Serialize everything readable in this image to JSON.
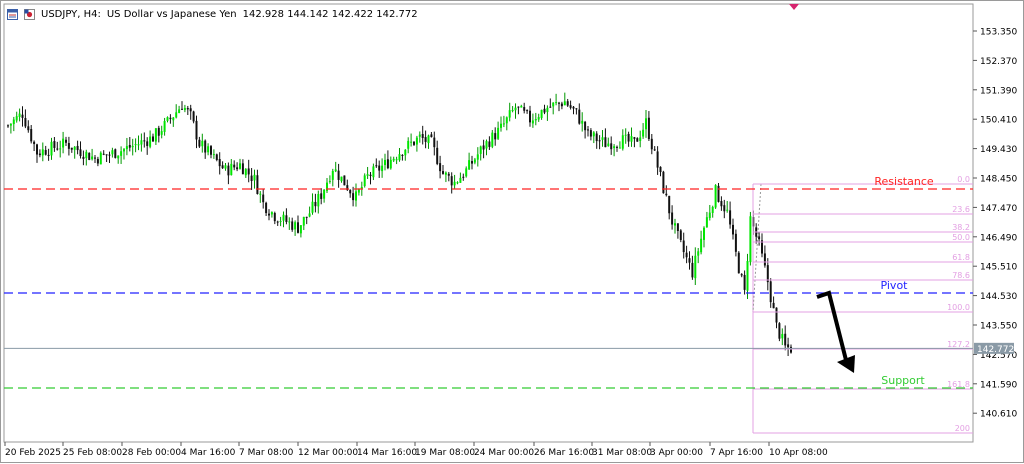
{
  "header": {
    "symbol_timeframe": "USDJPY, H4:",
    "description": "US Dollar vs Japanese Yen",
    "ohlc": "142.928 144.142 142.422 142.772"
  },
  "price_axis": {
    "ticks": [
      "153.350",
      "152.370",
      "151.390",
      "150.410",
      "149.430",
      "148.450",
      "147.470",
      "146.490",
      "145.510",
      "144.530",
      "143.550",
      "142.570",
      "141.590",
      "140.610"
    ],
    "current_price_label": "142.772"
  },
  "time_axis": {
    "labels": [
      "20 Feb 2025",
      "25 Feb 08:00",
      "28 Feb 00:00",
      "4 Mar 16:00",
      "7 Mar 08:00",
      "12 Mar 00:00",
      "14 Mar 16:00",
      "19 Mar 08:00",
      "24 Mar 00:00",
      "26 Mar 16:00",
      "31 Mar 08:00",
      "3 Apr 00:00",
      "7 Apr 16:00",
      "10 Apr 08:00"
    ]
  },
  "annotations": {
    "resistance": {
      "label": "Resistance",
      "price": 148.05,
      "color": "#ff2222"
    },
    "pivot": {
      "label": "Pivot",
      "price": 144.62,
      "color": "#2222ff"
    },
    "support": {
      "label": "Support",
      "price": 141.42,
      "color": "#33cc33"
    }
  },
  "fibonacci": {
    "color": "#e3a0e3",
    "levels": [
      "0.0",
      "23.6",
      "38.2",
      "50.0",
      "61.8",
      "78.6",
      "100.0",
      "127.2",
      "161.8",
      "200"
    ]
  },
  "colors": {
    "bull_candle": "#00e600",
    "bear_candle": "#111111",
    "current_price_line": "#8a9aa6",
    "axis_label_bg": "#8a9aa6",
    "arrow": "#000000"
  },
  "chart_data": {
    "type": "candlestick",
    "symbol": "USDJPY",
    "timeframe": "H4",
    "ylim": [
      140.0,
      154.0
    ],
    "horizontal_lines": [
      {
        "name": "Resistance",
        "y": 148.05
      },
      {
        "name": "Pivot",
        "y": 144.62
      },
      {
        "name": "Support",
        "y": 141.42
      }
    ],
    "approx_close_path": [
      [
        0,
        150.2
      ],
      [
        5,
        150.6
      ],
      [
        10,
        149.3
      ],
      [
        20,
        149.6
      ],
      [
        30,
        149.1
      ],
      [
        40,
        149.4
      ],
      [
        50,
        149.8
      ],
      [
        55,
        150.3
      ],
      [
        60,
        150.9
      ],
      [
        63,
        150.5
      ],
      [
        66,
        149.6
      ],
      [
        70,
        149.2
      ],
      [
        75,
        148.7
      ],
      [
        80,
        148.9
      ],
      [
        85,
        148.4
      ],
      [
        88,
        147.6
      ],
      [
        92,
        147.2
      ],
      [
        96,
        147.0
      ],
      [
        100,
        146.8
      ],
      [
        104,
        147.3
      ],
      [
        108,
        147.9
      ],
      [
        112,
        148.8
      ],
      [
        116,
        148.3
      ],
      [
        120,
        147.8
      ],
      [
        124,
        148.5
      ],
      [
        130,
        148.9
      ],
      [
        136,
        149.4
      ],
      [
        142,
        149.8
      ],
      [
        146,
        149.6
      ],
      [
        150,
        148.6
      ],
      [
        154,
        148.3
      ],
      [
        158,
        148.7
      ],
      [
        164,
        149.5
      ],
      [
        170,
        150.1
      ],
      [
        175,
        150.8
      ],
      [
        180,
        150.4
      ],
      [
        186,
        150.8
      ],
      [
        192,
        151.0
      ],
      [
        196,
        150.6
      ],
      [
        200,
        149.9
      ],
      [
        206,
        149.6
      ],
      [
        212,
        149.7
      ],
      [
        216,
        149.6
      ],
      [
        220,
        150.3
      ],
      [
        223,
        149.2
      ],
      [
        226,
        148.1
      ],
      [
        229,
        147.0
      ],
      [
        232,
        146.2
      ],
      [
        236,
        145.3
      ],
      [
        240,
        146.8
      ],
      [
        244,
        148.0
      ],
      [
        248,
        147.3
      ],
      [
        251,
        145.9
      ],
      [
        254,
        144.6
      ],
      [
        256,
        147.1
      ],
      [
        259,
        146.2
      ],
      [
        262,
        145.0
      ],
      [
        265,
        143.5
      ],
      [
        268,
        142.8
      ],
      [
        270,
        142.77
      ]
    ],
    "last": {
      "open": 142.928,
      "high": 144.142,
      "low": 142.422,
      "close": 142.772
    }
  }
}
